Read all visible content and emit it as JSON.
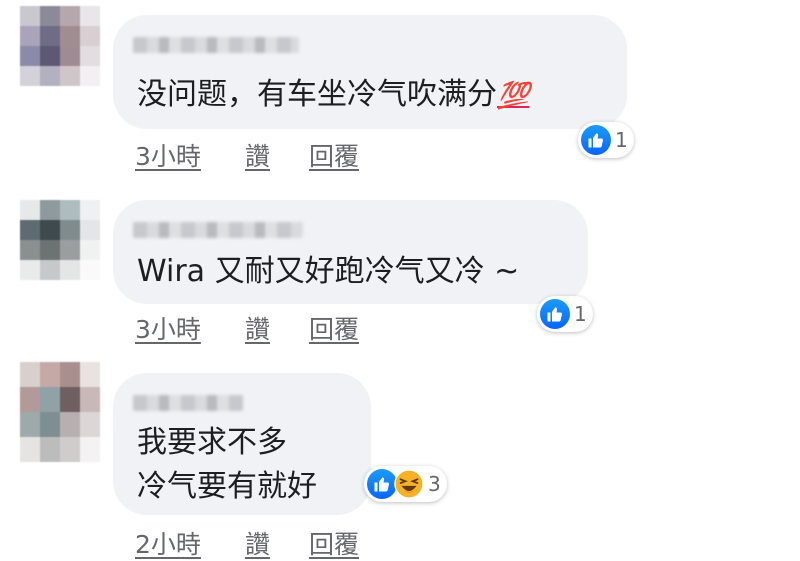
{
  "comments": [
    {
      "text": "没问题，有车坐冷气吹满分",
      "emoji": "💯",
      "emoji_name": "hundred-points-emoji",
      "time": "3小時",
      "like_action": "讚",
      "reply_action": "回覆",
      "reactions": [
        "like"
      ],
      "reaction_count": "1"
    },
    {
      "text": "Wira 又耐又好跑冷气又冷 ~",
      "time": "3小時",
      "like_action": "讚",
      "reply_action": "回覆",
      "reactions": [
        "like"
      ],
      "reaction_count": "1"
    },
    {
      "text_lines": [
        "我要求不多",
        "冷气要有就好"
      ],
      "time": "2小時",
      "like_action": "讚",
      "reply_action": "回覆",
      "reactions": [
        "like",
        "haha"
      ],
      "reaction_count": "3"
    }
  ],
  "colors": {
    "bubble": "#f0f2f5",
    "text": "#1c1e21",
    "meta": "#65676b",
    "like_blue": "#0866ff",
    "haha_yellow": "#f7b125"
  },
  "icons": [
    "blurred-avatar",
    "like-reaction-icon",
    "haha-reaction-icon",
    "hundred-points-emoji"
  ]
}
